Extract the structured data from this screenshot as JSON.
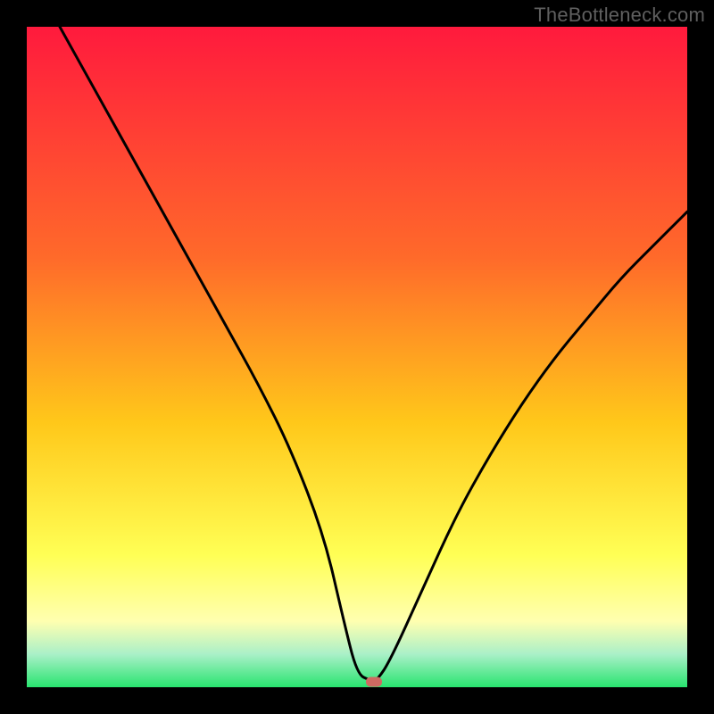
{
  "watermark": {
    "text": "TheBottleneck.com"
  },
  "colors": {
    "top": "#ff1a3d",
    "mid_upper": "#ff6a2a",
    "mid": "#ffc81a",
    "mid_lower": "#ffff55",
    "low_yellow": "#ffffb0",
    "low_mint": "#aaf0c8",
    "bottom": "#28e46f",
    "curve": "#000000",
    "marker": "#cf6a62",
    "frame": "#000000"
  },
  "chart_data": {
    "type": "line",
    "title": "",
    "xlabel": "",
    "ylabel": "",
    "xlim": [
      0,
      100
    ],
    "ylim": [
      0,
      100
    ],
    "series": [
      {
        "name": "bottleneck-curve",
        "x": [
          5,
          10,
          15,
          20,
          25,
          30,
          35,
          40,
          45,
          48,
          50,
          52,
          53,
          55,
          60,
          65,
          70,
          75,
          80,
          85,
          90,
          95,
          100
        ],
        "values": [
          100,
          91,
          82,
          73,
          64,
          55,
          46,
          36,
          23,
          10,
          2,
          1,
          1,
          4,
          15,
          26,
          35,
          43,
          50,
          56,
          62,
          67,
          72
        ]
      }
    ],
    "marker": {
      "x": 52.5,
      "y": 0.8,
      "name": "optimal-point"
    },
    "gradient_stops": [
      {
        "pct": 0,
        "color_key": "top"
      },
      {
        "pct": 35,
        "color_key": "mid_upper"
      },
      {
        "pct": 60,
        "color_key": "mid"
      },
      {
        "pct": 80,
        "color_key": "mid_lower"
      },
      {
        "pct": 90,
        "color_key": "low_yellow"
      },
      {
        "pct": 95,
        "color_key": "low_mint"
      },
      {
        "pct": 100,
        "color_key": "bottom"
      }
    ]
  }
}
